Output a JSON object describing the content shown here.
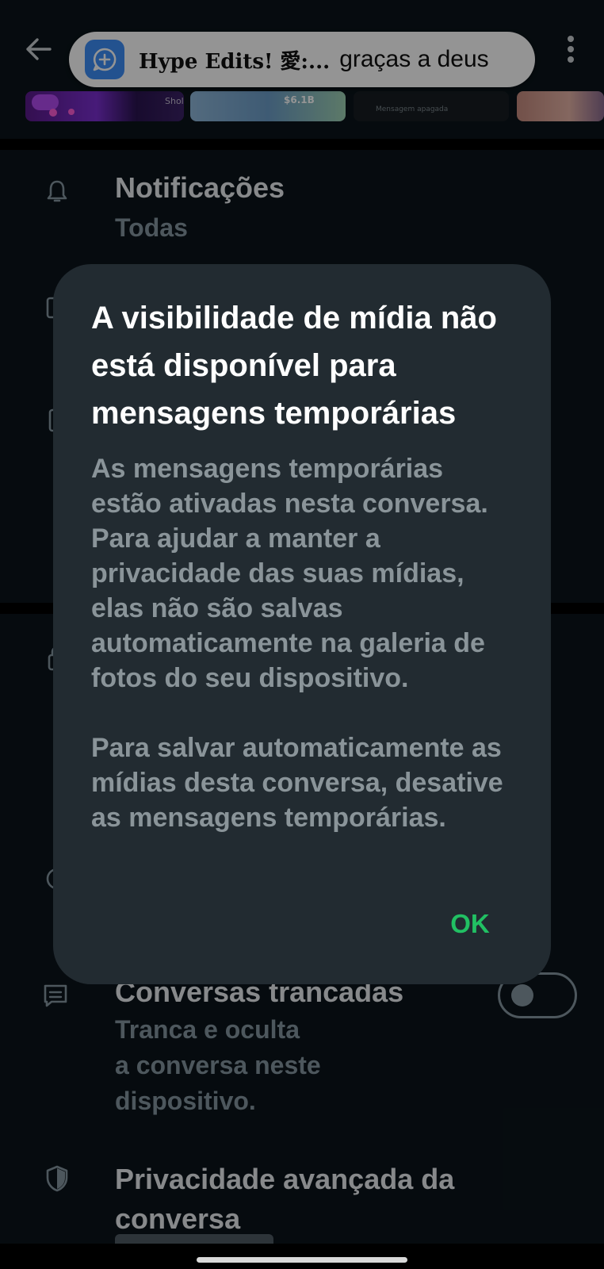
{
  "notification": {
    "sender": "Hype Edits! 愛:...",
    "message": "graças a deus"
  },
  "media_strip": {
    "thumb1_text": "Shol",
    "thumb2_text": "$6.1B",
    "thumb3_text": "Mensagem apagada"
  },
  "settings": {
    "notifications_title": "Notificações",
    "notifications_value": "Todas",
    "locked_chats_title": "Conversas trancadas",
    "locked_chats_subtitle": [
      "Tranca e oculta",
      "a conversa neste",
      "dispositivo."
    ],
    "locked_chats_toggle_on": false,
    "advanced_privacy_title": "Privacidade avançada da conversa"
  },
  "dialog": {
    "title": "A visibilidade de mídia não está disponível para mensagens temporárias",
    "body_paragraph_1": "As mensagens temporárias estão ativadas nesta conversa. Para ajudar a manter a privacidade das suas mídias, elas não são salvas automaticamente na galeria de fotos do seu dispositivo.",
    "body_paragraph_2": "Para salvar automaticamente as mídias desta conversa, desative as mensagens temporárias.",
    "ok_label": "OK"
  },
  "icons": {
    "back": "arrow-left-icon",
    "menu": "more-vert-icon",
    "notifications": "bell-icon",
    "locked_chats": "chat-lock-icon",
    "advanced_privacy": "shield-icon"
  },
  "colors": {
    "background": "#0b141a",
    "dialog_bg": "#222b31",
    "accent_green": "#21c063",
    "secondary_text": "#8696a0"
  }
}
